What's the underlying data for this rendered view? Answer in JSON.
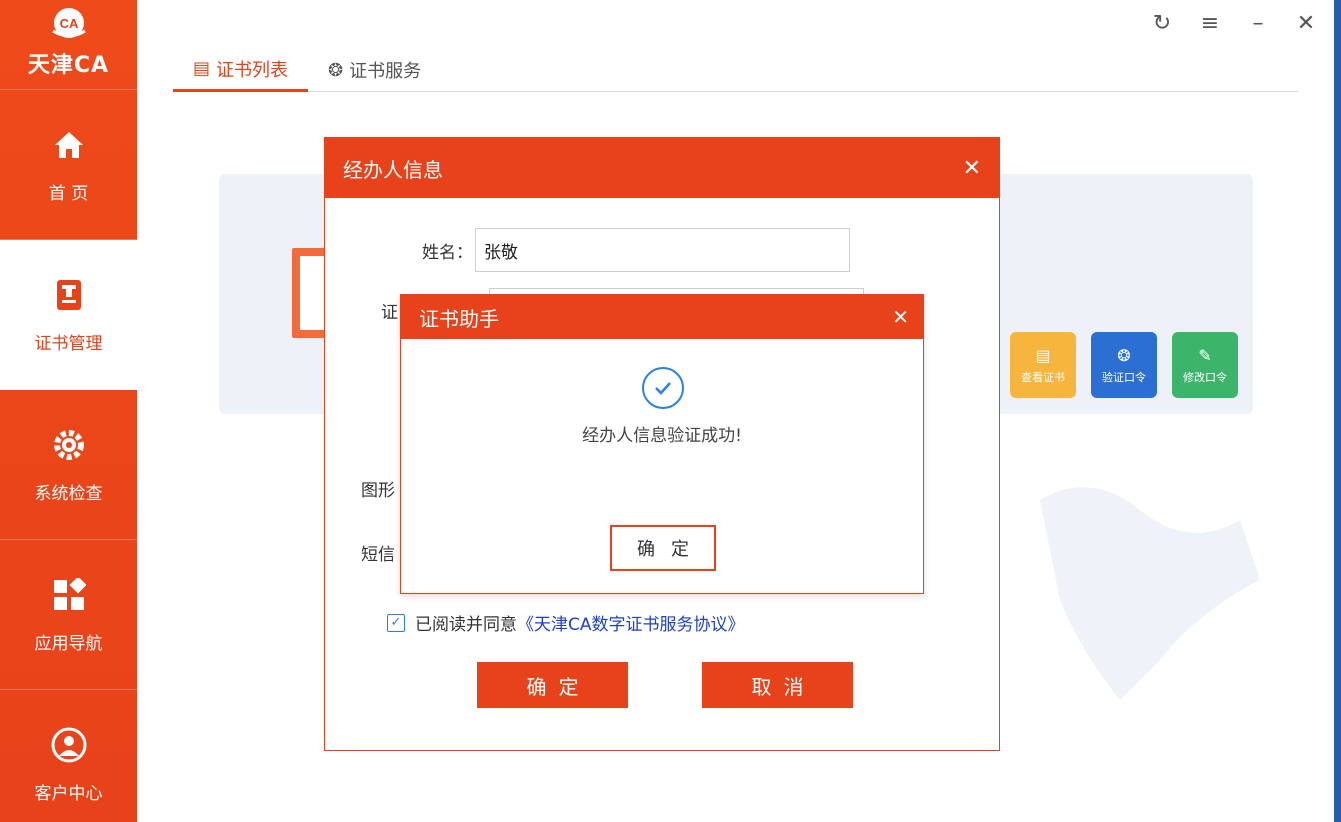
{
  "app": {
    "logo_text": "天津CA"
  },
  "sidebar": {
    "items": [
      {
        "label": "首 页",
        "icon": "home-icon",
        "active": false
      },
      {
        "label": "证书管理",
        "icon": "certificate-icon",
        "active": true
      },
      {
        "label": "系统检查",
        "icon": "gear-check-icon",
        "active": false
      },
      {
        "label": "应用导航",
        "icon": "apps-icon",
        "active": false
      },
      {
        "label": "客户中心",
        "icon": "customer-icon",
        "active": false
      }
    ]
  },
  "window_controls": {
    "refresh": "refresh-icon",
    "menu": "menu-icon",
    "minimize": "minimize-icon",
    "close": "close-icon"
  },
  "tabs": [
    {
      "label": "证书列表",
      "icon": "list-icon",
      "active": true
    },
    {
      "label": "证书服务",
      "icon": "badge-icon",
      "active": false
    }
  ],
  "quick_actions": [
    {
      "label": "查看证书",
      "color": "#f6b63d"
    },
    {
      "label": "验证口令",
      "color": "#2b6fd3"
    },
    {
      "label": "修改口令",
      "color": "#3cb56a"
    }
  ],
  "operator_dialog": {
    "title": "经办人信息",
    "name_label": "姓名：",
    "name_value": "张敬",
    "id_label_partial": "证",
    "captcha_label_partial": "图形",
    "sms_label_partial": "短信",
    "agree_text": "已阅读并同意",
    "agree_link": "《天津CA数字证书服务协议》",
    "confirm": "确定",
    "cancel": "取消"
  },
  "helper_dialog": {
    "title": "证书助手",
    "message": "经办人信息验证成功!",
    "confirm": "确定"
  },
  "colors": {
    "brand": "#e8421a",
    "link": "#1d3fd0",
    "success": "#2b80e8"
  }
}
